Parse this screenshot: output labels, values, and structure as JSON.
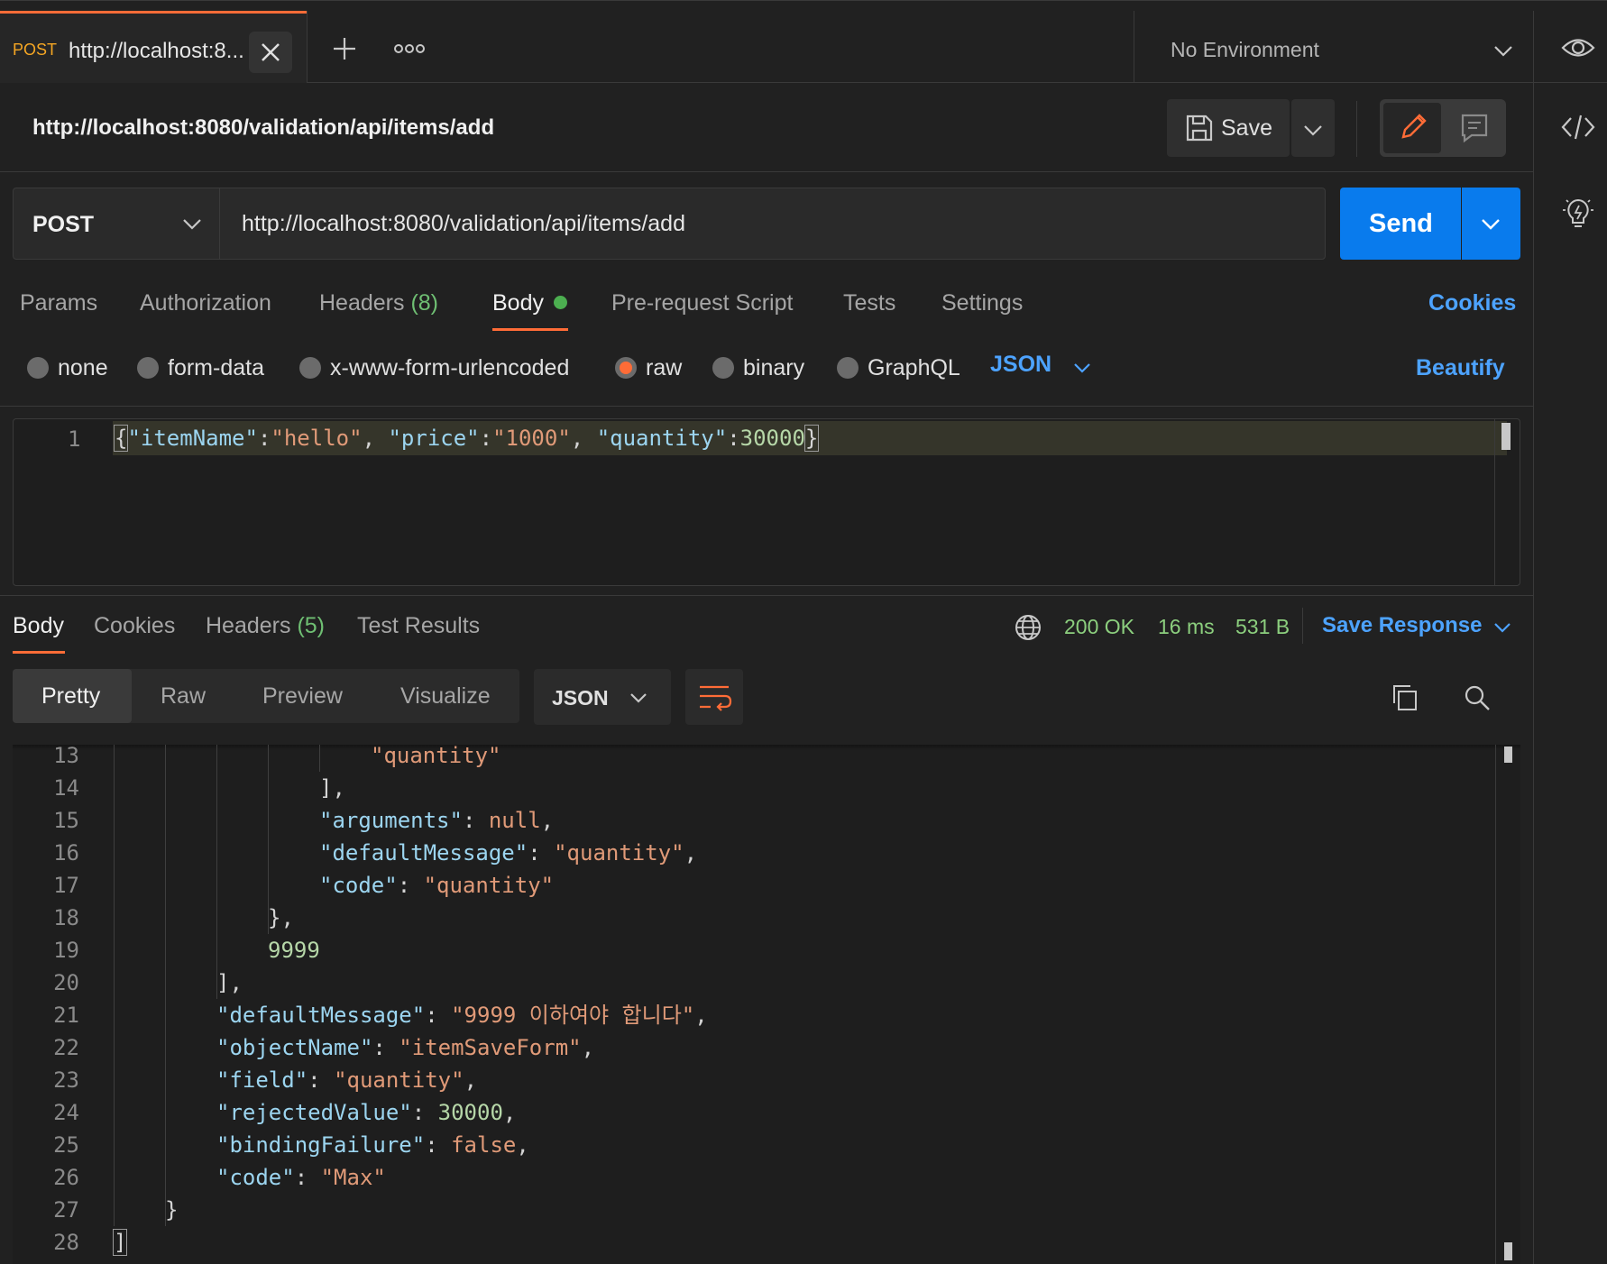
{
  "tab": {
    "method": "POST",
    "title": "http://localhost:8...",
    "environment": "No Environment"
  },
  "request": {
    "name": "http://localhost:8080/validation/api/items/add",
    "method": "POST",
    "url": "http://localhost:8080/validation/api/items/add",
    "save_label": "Save",
    "send_label": "Send"
  },
  "req_tabs": {
    "params": "Params",
    "authorization": "Authorization",
    "headers": "Headers",
    "headers_count": "(8)",
    "body": "Body",
    "prerequest": "Pre-request Script",
    "tests": "Tests",
    "settings": "Settings",
    "cookies": "Cookies"
  },
  "body_modes": {
    "none": "none",
    "form_data": "form-data",
    "urlencoded": "x-www-form-urlencoded",
    "raw": "raw",
    "binary": "binary",
    "graphql": "GraphQL",
    "format": "JSON",
    "beautify": "Beautify",
    "selected": "raw"
  },
  "request_body": {
    "line": "1",
    "tokens": [
      "{",
      "\"itemName\"",
      ":",
      "\"hello\"",
      ",",
      "\"price\"",
      ":",
      "\"1000\"",
      ",",
      "\"quantity\"",
      ":",
      "30000",
      "}"
    ]
  },
  "resp_tabs": {
    "body": "Body",
    "cookies": "Cookies",
    "headers": "Headers",
    "headers_count": "(5)",
    "test_results": "Test Results"
  },
  "resp_meta": {
    "status": "200 OK",
    "time": "16 ms",
    "size": "531 B",
    "save_response": "Save Response"
  },
  "view_tabs": {
    "pretty": "Pretty",
    "raw": "Raw",
    "preview": "Preview",
    "visualize": "Visualize",
    "format": "JSON"
  },
  "response_lines": [
    {
      "n": "13",
      "text": "\"quantity\""
    },
    {
      "n": "14",
      "text": "],"
    },
    {
      "n": "15",
      "text": "\"arguments\": null,"
    },
    {
      "n": "16",
      "text": "\"defaultMessage\": \"quantity\","
    },
    {
      "n": "17",
      "text": "\"code\": \"quantity\""
    },
    {
      "n": "18",
      "text": "},"
    },
    {
      "n": "19",
      "text": "9999"
    },
    {
      "n": "20",
      "text": "],"
    },
    {
      "n": "21",
      "text": "\"defaultMessage\": \"9999 이하여야 합니다\","
    },
    {
      "n": "22",
      "text": "\"objectName\": \"itemSaveForm\","
    },
    {
      "n": "23",
      "text": "\"field\": \"quantity\","
    },
    {
      "n": "24",
      "text": "\"rejectedValue\": 30000,"
    },
    {
      "n": "25",
      "text": "\"bindingFailure\": false,"
    },
    {
      "n": "26",
      "text": "\"code\": \"Max\""
    },
    {
      "n": "27",
      "text": "}"
    },
    {
      "n": "28",
      "text": "]"
    }
  ],
  "colors": {
    "accent_orange": "#ff6c37",
    "send_blue": "#097bed",
    "link_blue": "#4da3ff",
    "success_green": "#4caf50",
    "status_green": "#8ccf7e"
  }
}
